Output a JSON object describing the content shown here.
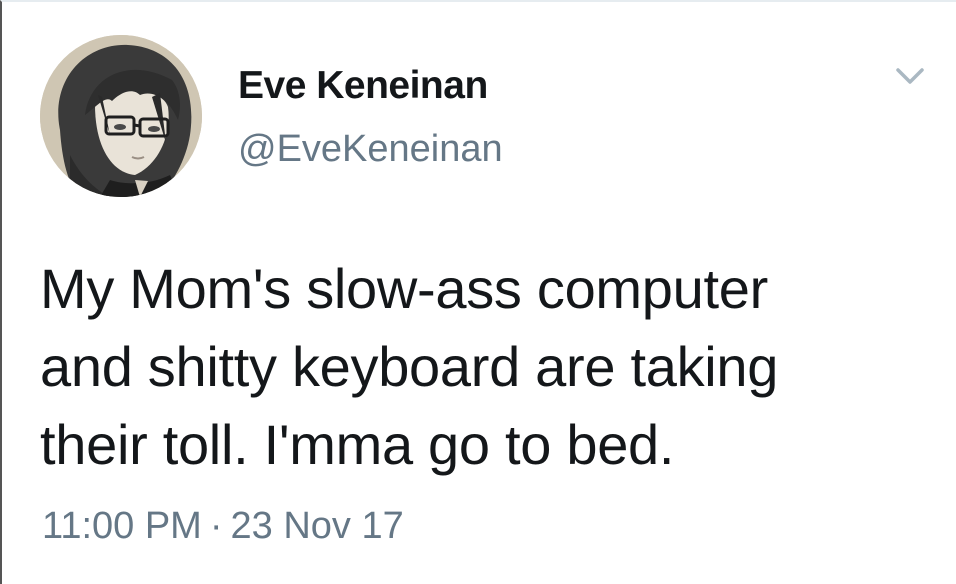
{
  "tweet": {
    "display_name": "Eve Keneinan",
    "handle": "@EveKeneinan",
    "text": "My Mom's slow-ass computer\nand shitty keyboard are taking\ntheir toll. I'mma go to bed.",
    "time": "11:00 PM",
    "separator": "·",
    "date": "23 Nov 17"
  },
  "icons": {
    "menu": "chevron-down-icon",
    "avatar": "anime-girl-with-glasses"
  },
  "colors": {
    "name": "#14171a",
    "secondary": "#657786",
    "chevron": "#aab8c2",
    "background": "#ffffff"
  }
}
